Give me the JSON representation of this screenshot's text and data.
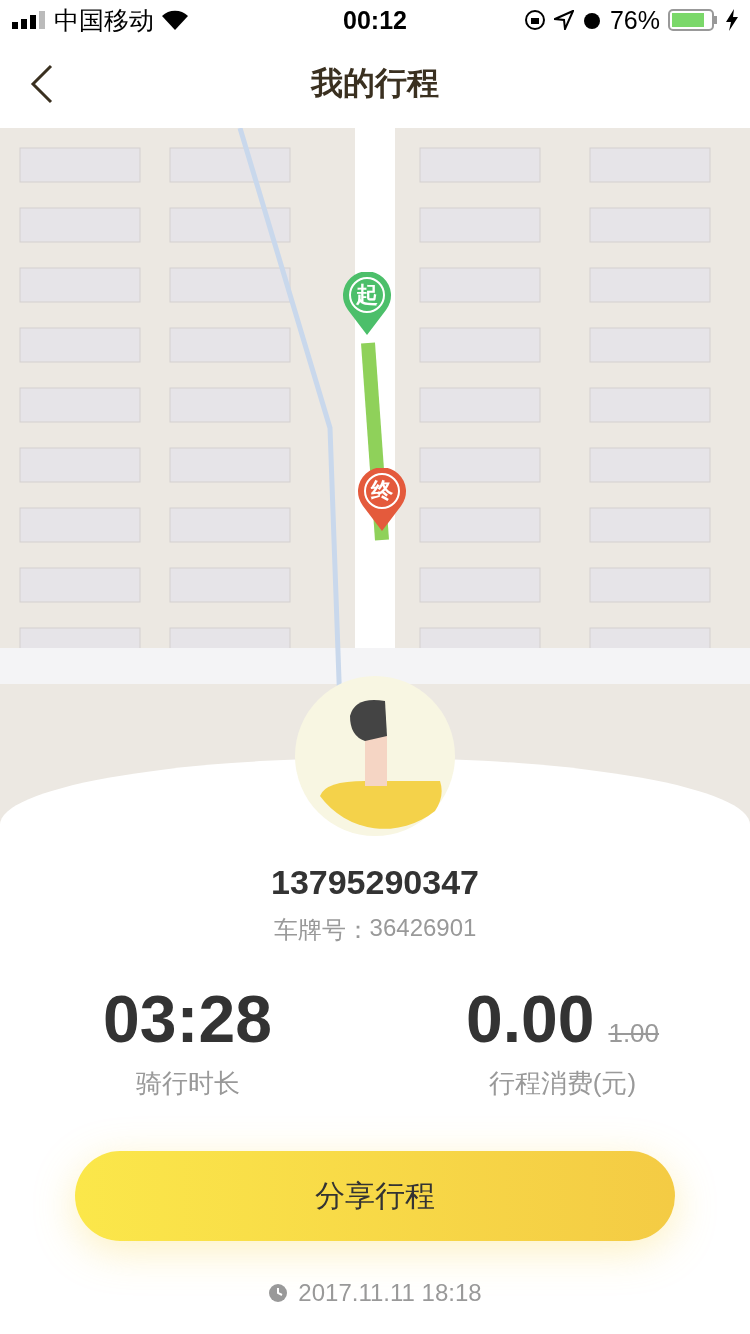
{
  "status_bar": {
    "carrier": "中国移动",
    "time": "00:12",
    "battery": "76%"
  },
  "nav": {
    "title": "我的行程"
  },
  "map": {
    "start_marker": "起",
    "end_marker": "终"
  },
  "trip": {
    "phone": "13795290347",
    "plate_label": "车牌号：",
    "plate": "36426901",
    "stats": [
      {
        "value": "03:28",
        "label": "骑行时长"
      },
      {
        "value": "0.00",
        "original": "1.00",
        "label": "行程消费(元)"
      }
    ],
    "share_button": "分享行程",
    "date": "2017.11.11 18:18"
  }
}
